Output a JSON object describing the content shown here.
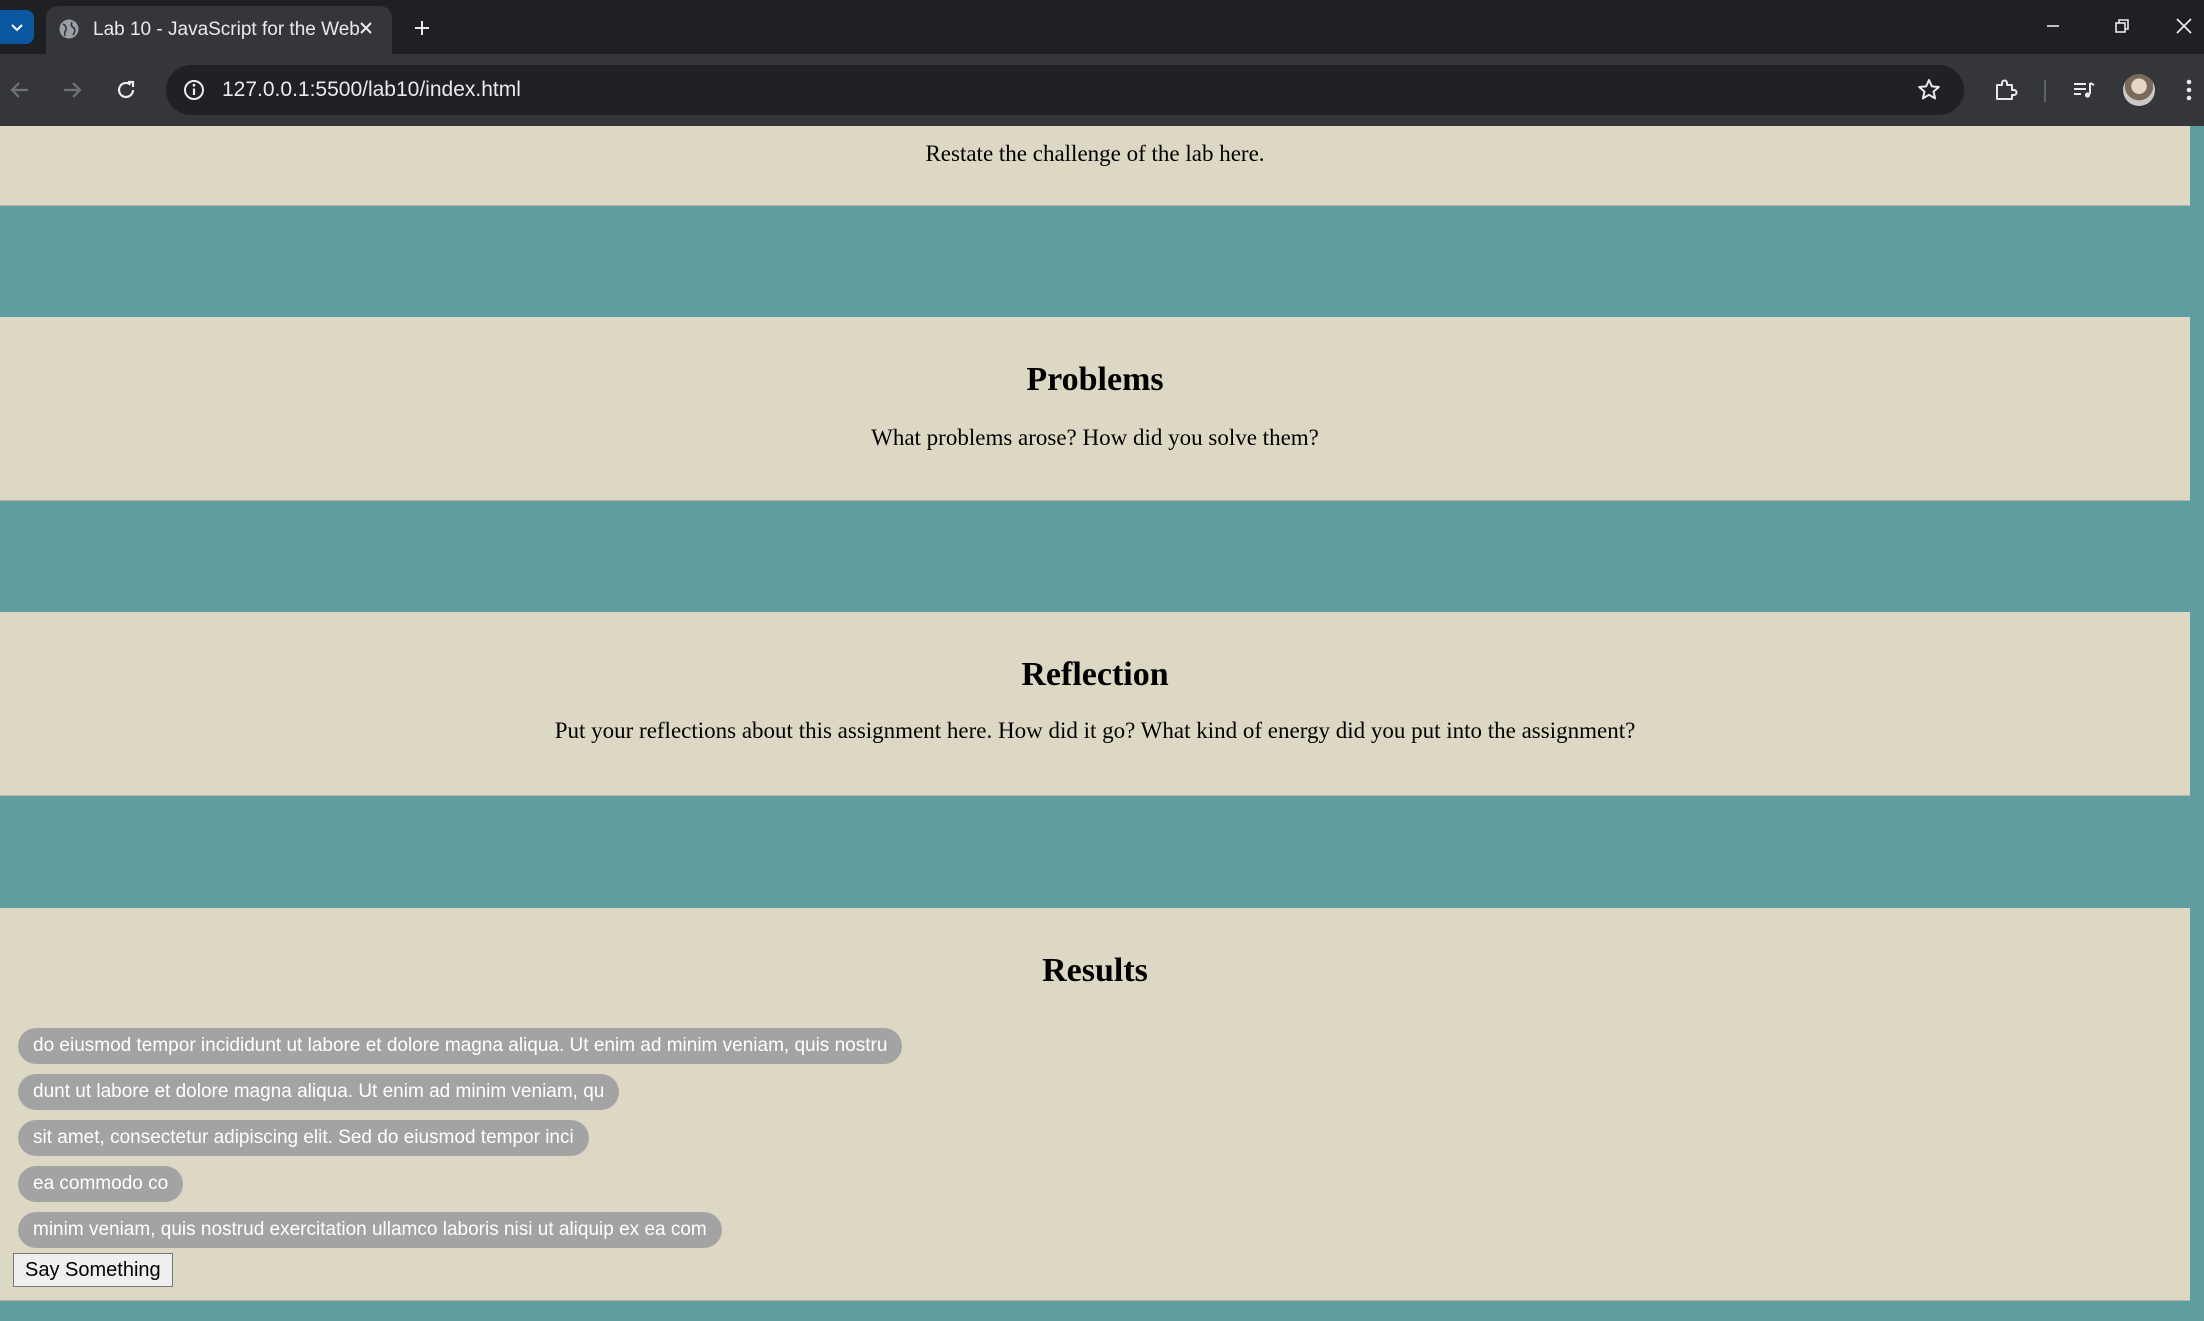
{
  "browser": {
    "tab_title": "Lab 10 - JavaScript for the Web",
    "url": "127.0.0.1:5500/lab10/index.html",
    "accent": "#0b57a0"
  },
  "page": {
    "challenge_text": "Restate the challenge of the lab here.",
    "problems": {
      "heading": "Problems",
      "text": "What problems arose? How did you solve them?"
    },
    "reflection": {
      "heading": "Reflection",
      "text": "Put your reflections about this assignment here. How did it go? What kind of energy did you put into the assignment?"
    },
    "results": {
      "heading": "Results",
      "messages": [
        "do eiusmod tempor incididunt ut labore et dolore magna aliqua. Ut enim ad minim veniam, quis nostru",
        "dunt ut labore et dolore magna aliqua. Ut enim ad minim veniam, qu",
        "sit amet, consectetur adipiscing elit. Sed do eiusmod tempor inci",
        "ea commodo co",
        "minim veniam, quis nostrud exercitation ullamco laboris nisi ut aliquip ex ea com"
      ],
      "button_label": "Say Something"
    }
  },
  "colors": {
    "page_background": "#5f9ea0",
    "section_background": "#ddd8c4",
    "message_pill": "#a3a3a3"
  },
  "icons": [
    "tab-list-icon",
    "globe-favicon-icon",
    "close-tab-icon",
    "new-tab-icon",
    "minimize-icon",
    "restore-icon",
    "close-window-icon",
    "back-icon",
    "forward-icon",
    "reload-icon",
    "site-info-icon",
    "bookmark-star-icon",
    "extensions-icon",
    "media-controls-icon",
    "profile-avatar",
    "more-menu-icon"
  ]
}
